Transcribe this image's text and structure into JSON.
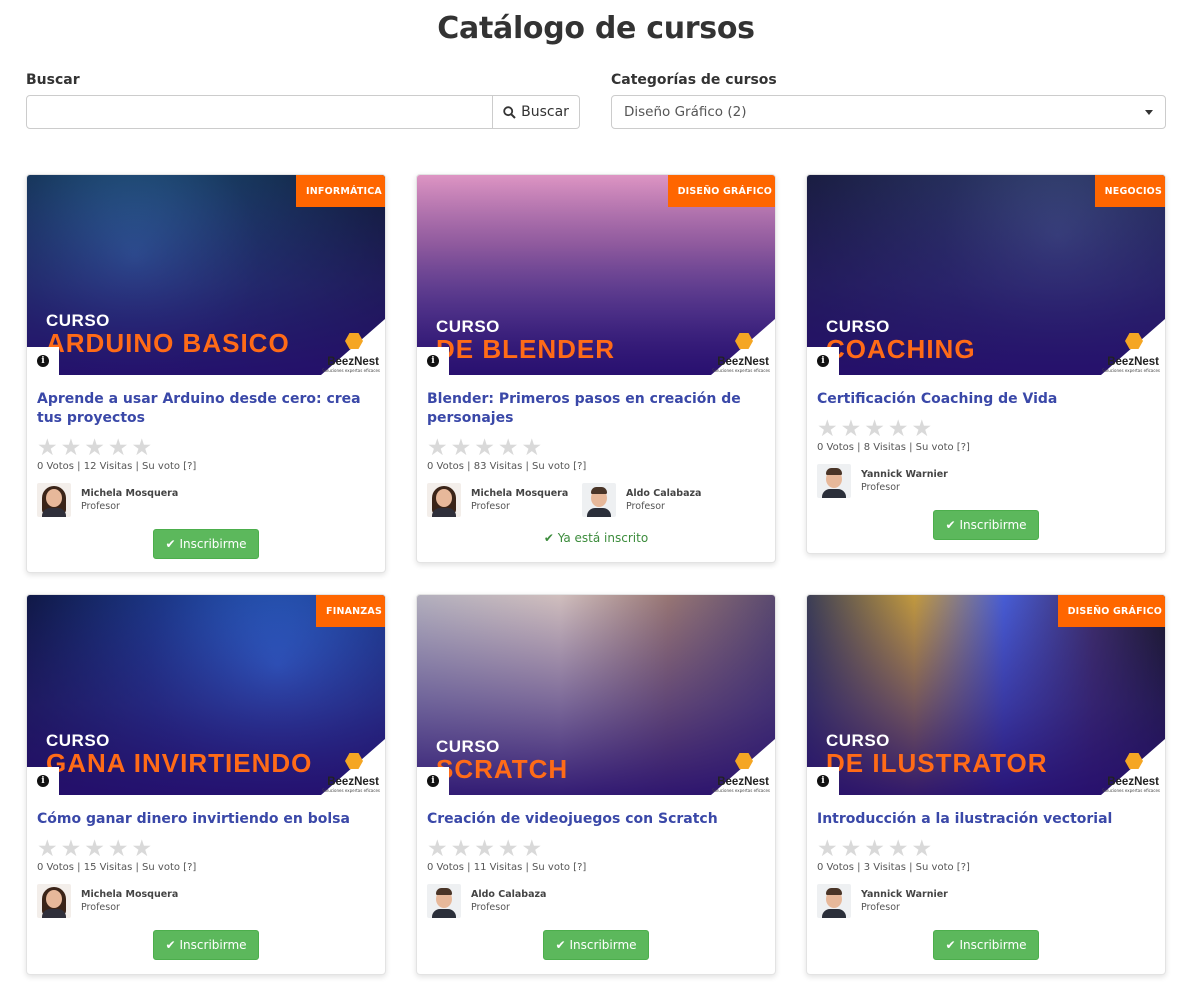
{
  "page": {
    "title": "Catálogo de cursos"
  },
  "search": {
    "label": "Buscar",
    "button_label": "Buscar",
    "value": ""
  },
  "category_filter": {
    "label": "Categorías de cursos",
    "selected": "Diseño Gráfico (2)"
  },
  "common": {
    "banner_prefix": "CURSO",
    "logo_text": "BeezNest",
    "logo_sub": "Soluciones expertas eficaces",
    "info_glyph": "i",
    "role": "Profesor",
    "votes_sep": "|",
    "your_vote": "Su voto [?]",
    "enroll_label": "Inscribirme",
    "enrolled_label": "Ya está inscrito"
  },
  "colors": {
    "badge": "#ff6600",
    "title_link": "#3a48a8",
    "enroll": "#5cb85c",
    "banner_orange": "#ff6b17",
    "banner_purple": "#2a1070"
  },
  "icons": {
    "search": "search-icon",
    "info": "info-icon",
    "check": "check-icon",
    "star": "star-icon"
  },
  "courses": [
    {
      "category": "INFORMÁTICA",
      "banner": "ARDUINO BASICO",
      "title": "Aprende a usar Arduino desde cero: crea tus proyectos",
      "votes": "0 Votos",
      "visits": "12 Visitas",
      "rating": 0,
      "teachers": [
        {
          "name": "Michela Mosquera",
          "role": "Profesor"
        }
      ],
      "enrolled": false
    },
    {
      "category": "DISEÑO GRÁFICO",
      "banner": "DE BLENDER",
      "title": "Blender: Primeros pasos en creación de personajes",
      "votes": "0 Votos",
      "visits": "83 Visitas",
      "rating": 0,
      "teachers": [
        {
          "name": "Michela Mosquera",
          "role": "Profesor"
        },
        {
          "name": "Aldo Calabaza",
          "role": "Profesor"
        }
      ],
      "enrolled": true
    },
    {
      "category": "NEGOCIOS",
      "banner": "COACHING",
      "title": "Certificación Coaching de Vida",
      "votes": "0 Votos",
      "visits": "8 Visitas",
      "rating": 0,
      "teachers": [
        {
          "name": "Yannick Warnier",
          "role": "Profesor"
        }
      ],
      "enrolled": false
    },
    {
      "category": "FINANZAS",
      "banner": "GANA INVIRTIENDO",
      "title": "Cómo ganar dinero invirtiendo en bolsa",
      "votes": "0 Votos",
      "visits": "15 Visitas",
      "rating": 0,
      "teachers": [
        {
          "name": "Michela Mosquera",
          "role": "Profesor"
        }
      ],
      "enrolled": false
    },
    {
      "category": "",
      "banner": "SCRATCH",
      "title": "Creación de videojuegos con Scratch",
      "votes": "0 Votos",
      "visits": "11 Visitas",
      "rating": 0,
      "teachers": [
        {
          "name": "Aldo Calabaza",
          "role": "Profesor"
        }
      ],
      "enrolled": false
    },
    {
      "category": "DISEÑO GRÁFICO",
      "banner": "DE ILUSTRATOR",
      "title": "Introducción a la ilustración vectorial",
      "votes": "0 Votos",
      "visits": "3 Visitas",
      "rating": 0,
      "teachers": [
        {
          "name": "Yannick Warnier",
          "role": "Profesor"
        }
      ],
      "enrolled": false
    }
  ]
}
